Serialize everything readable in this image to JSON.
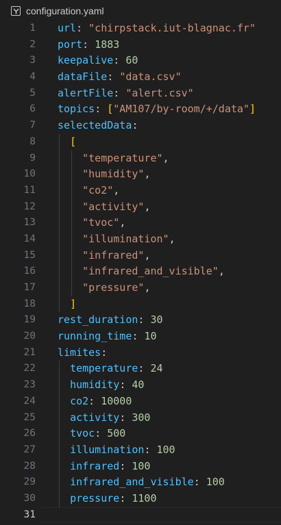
{
  "tab": {
    "icon": "yaml-file-icon",
    "filename": "configuration.yaml"
  },
  "colors": {
    "key": "#4fc1ff",
    "string": "#ce9178",
    "number": "#b5cea8",
    "bracket_outer": "#ffd700",
    "bracket_inner": "#da70d6"
  },
  "lines": [
    {
      "n": "1",
      "segs": [
        [
          "k",
          "url"
        ],
        [
          "p",
          ": "
        ],
        [
          "s",
          "\"chirpstack.iut-blagnac.fr\""
        ]
      ]
    },
    {
      "n": "2",
      "segs": [
        [
          "k",
          "port"
        ],
        [
          "p",
          ": "
        ],
        [
          "n",
          "1883"
        ]
      ]
    },
    {
      "n": "3",
      "segs": [
        [
          "k",
          "keepalive"
        ],
        [
          "p",
          ": "
        ],
        [
          "n",
          "60"
        ]
      ]
    },
    {
      "n": "4",
      "segs": [
        [
          "k",
          "dataFile"
        ],
        [
          "p",
          ": "
        ],
        [
          "s",
          "\"data.csv\""
        ]
      ]
    },
    {
      "n": "5",
      "segs": [
        [
          "k",
          "alertFile"
        ],
        [
          "p",
          ": "
        ],
        [
          "s",
          "\"alert.csv\""
        ]
      ]
    },
    {
      "n": "6",
      "segs": [
        [
          "k",
          "topics"
        ],
        [
          "p",
          ": "
        ],
        [
          "b1",
          "["
        ],
        [
          "s",
          "\"AM107/by-room/+/data\""
        ],
        [
          "b1",
          "]"
        ]
      ]
    },
    {
      "n": "7",
      "segs": [
        [
          "k",
          "selectedData"
        ],
        [
          "p",
          ":"
        ]
      ]
    },
    {
      "n": "8",
      "segs": [
        [
          "p",
          "  "
        ],
        [
          "b1",
          "["
        ]
      ]
    },
    {
      "n": "9",
      "segs": [
        [
          "p",
          "    "
        ],
        [
          "s",
          "\"temperature\""
        ],
        [
          "p",
          ","
        ]
      ]
    },
    {
      "n": "10",
      "segs": [
        [
          "p",
          "    "
        ],
        [
          "s",
          "\"humidity\""
        ],
        [
          "p",
          ","
        ]
      ]
    },
    {
      "n": "11",
      "segs": [
        [
          "p",
          "    "
        ],
        [
          "s",
          "\"co2\""
        ],
        [
          "p",
          ","
        ]
      ]
    },
    {
      "n": "12",
      "segs": [
        [
          "p",
          "    "
        ],
        [
          "s",
          "\"activity\""
        ],
        [
          "p",
          ","
        ]
      ]
    },
    {
      "n": "13",
      "segs": [
        [
          "p",
          "    "
        ],
        [
          "s",
          "\"tvoc\""
        ],
        [
          "p",
          ","
        ]
      ]
    },
    {
      "n": "14",
      "segs": [
        [
          "p",
          "    "
        ],
        [
          "s",
          "\"illumination\""
        ],
        [
          "p",
          ","
        ]
      ]
    },
    {
      "n": "15",
      "segs": [
        [
          "p",
          "    "
        ],
        [
          "s",
          "\"infrared\""
        ],
        [
          "p",
          ","
        ]
      ]
    },
    {
      "n": "16",
      "segs": [
        [
          "p",
          "    "
        ],
        [
          "s",
          "\"infrared_and_visible\""
        ],
        [
          "p",
          ","
        ]
      ]
    },
    {
      "n": "17",
      "segs": [
        [
          "p",
          "    "
        ],
        [
          "s",
          "\"pressure\""
        ],
        [
          "p",
          ","
        ]
      ]
    },
    {
      "n": "18",
      "segs": [
        [
          "p",
          "  "
        ],
        [
          "b1",
          "]"
        ]
      ]
    },
    {
      "n": "19",
      "segs": [
        [
          "k",
          "rest_duration"
        ],
        [
          "p",
          ": "
        ],
        [
          "n",
          "30"
        ]
      ]
    },
    {
      "n": "20",
      "segs": [
        [
          "k",
          "running_time"
        ],
        [
          "p",
          ": "
        ],
        [
          "n",
          "10"
        ]
      ]
    },
    {
      "n": "21",
      "segs": [
        [
          "k",
          "limites"
        ],
        [
          "p",
          ":"
        ]
      ]
    },
    {
      "n": "22",
      "segs": [
        [
          "p",
          "  "
        ],
        [
          "k",
          "temperature"
        ],
        [
          "p",
          ": "
        ],
        [
          "n",
          "24"
        ]
      ]
    },
    {
      "n": "23",
      "segs": [
        [
          "p",
          "  "
        ],
        [
          "k",
          "humidity"
        ],
        [
          "p",
          ": "
        ],
        [
          "n",
          "40"
        ]
      ]
    },
    {
      "n": "24",
      "segs": [
        [
          "p",
          "  "
        ],
        [
          "k",
          "co2"
        ],
        [
          "p",
          ": "
        ],
        [
          "n",
          "10000"
        ]
      ]
    },
    {
      "n": "25",
      "segs": [
        [
          "p",
          "  "
        ],
        [
          "k",
          "activity"
        ],
        [
          "p",
          ": "
        ],
        [
          "n",
          "300"
        ]
      ]
    },
    {
      "n": "26",
      "segs": [
        [
          "p",
          "  "
        ],
        [
          "k",
          "tvoc"
        ],
        [
          "p",
          ": "
        ],
        [
          "n",
          "500"
        ]
      ]
    },
    {
      "n": "27",
      "segs": [
        [
          "p",
          "  "
        ],
        [
          "k",
          "illumination"
        ],
        [
          "p",
          ": "
        ],
        [
          "n",
          "100"
        ]
      ]
    },
    {
      "n": "28",
      "segs": [
        [
          "p",
          "  "
        ],
        [
          "k",
          "infrared"
        ],
        [
          "p",
          ": "
        ],
        [
          "n",
          "100"
        ]
      ]
    },
    {
      "n": "29",
      "segs": [
        [
          "p",
          "  "
        ],
        [
          "k",
          "infrared_and_visible"
        ],
        [
          "p",
          ": "
        ],
        [
          "n",
          "100"
        ]
      ]
    },
    {
      "n": "30",
      "segs": [
        [
          "p",
          "  "
        ],
        [
          "k",
          "pressure"
        ],
        [
          "p",
          ": "
        ],
        [
          "n",
          "1100"
        ]
      ]
    },
    {
      "n": "31",
      "segs": [],
      "active": true
    }
  ]
}
